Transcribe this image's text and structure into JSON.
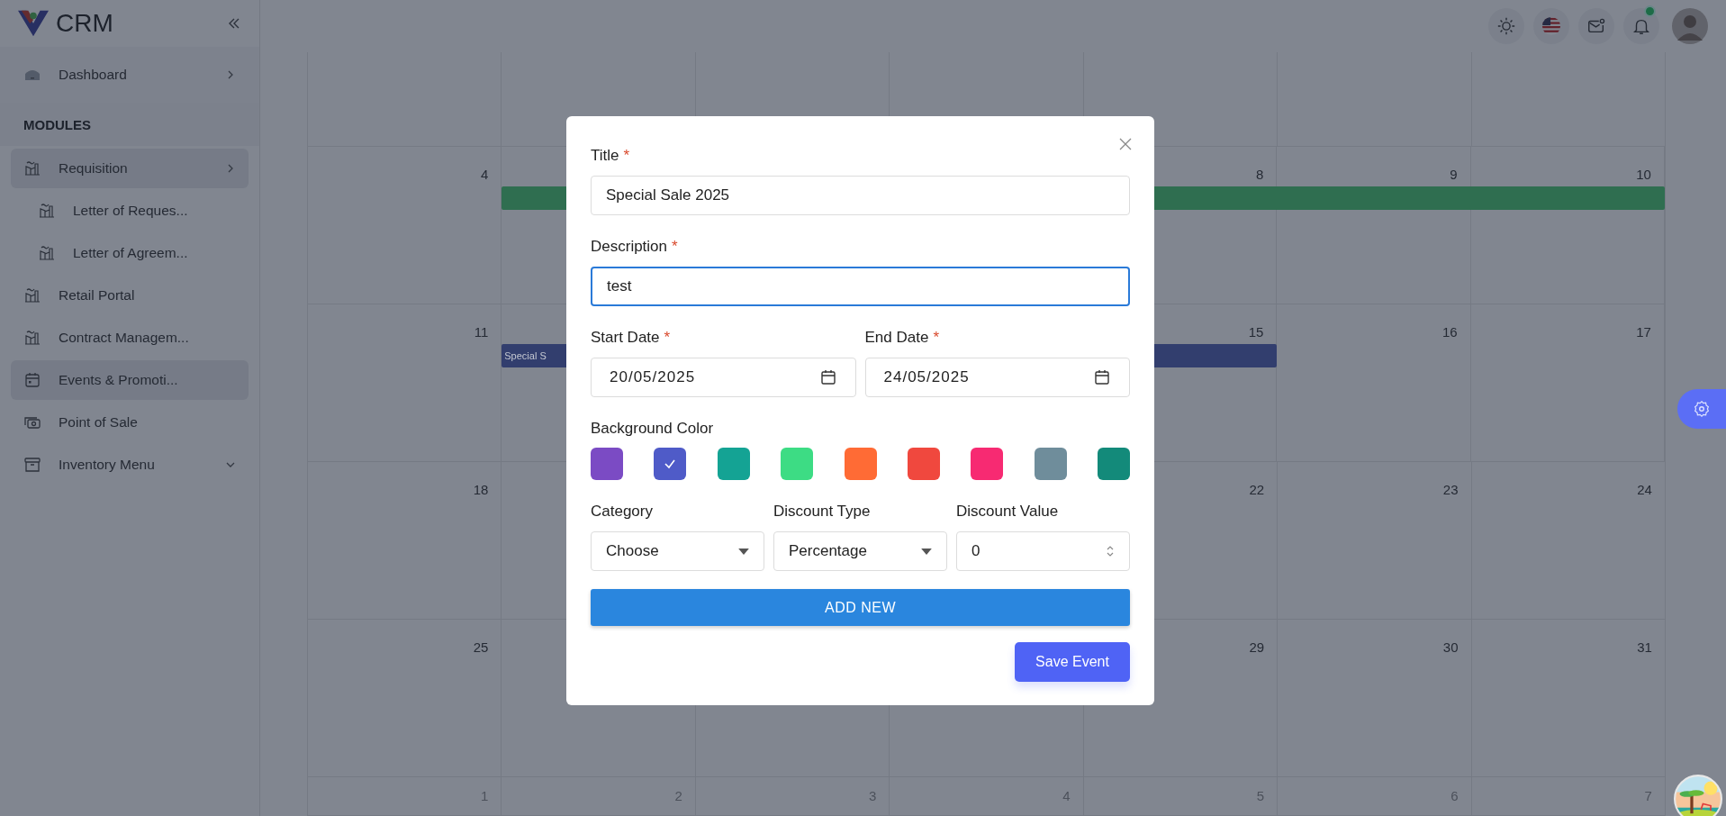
{
  "sidebar": {
    "logo": "CRM",
    "items": [
      {
        "kind": "item",
        "label": "Dashboard",
        "expanded": false,
        "selected": false
      },
      {
        "kind": "section",
        "label": "MODULES"
      },
      {
        "kind": "item",
        "label": "Requisition",
        "expanded": false,
        "selected": true,
        "children": [
          {
            "kind": "item",
            "label": "Letter of Reques...",
            "selected": false
          },
          {
            "kind": "item",
            "label": "Letter of Agreem...",
            "selected": false
          }
        ]
      },
      {
        "kind": "item",
        "label": "Retail Portal",
        "selected": false
      },
      {
        "kind": "item",
        "label": "Contract Managem...",
        "selected": false
      },
      {
        "kind": "item",
        "label": "Events & Promoti...",
        "selected": true
      },
      {
        "kind": "item",
        "label": "Point of Sale",
        "selected": false
      },
      {
        "kind": "item",
        "label": "Inventory Menu",
        "expanded": true,
        "selected": false
      }
    ]
  },
  "calendar": {
    "weeks": [
      {
        "kind": "blank"
      },
      {
        "kind": "dated",
        "days": [
          "4",
          "8",
          "9",
          "10"
        ],
        "other_month": false,
        "events": [
          {
            "color": "#2f6e50"
          }
        ]
      },
      {
        "kind": "dated",
        "days": [
          "11",
          "15",
          "16",
          "17"
        ],
        "other_month": false,
        "events": [
          {
            "label": "Special S",
            "color": "#323e6e"
          }
        ]
      },
      {
        "kind": "dated",
        "days": [
          "18",
          "22",
          "23",
          "24"
        ],
        "other_month": false
      },
      {
        "kind": "dated",
        "days": [
          "25",
          "29",
          "30",
          "31"
        ],
        "other_month": false
      },
      {
        "kind": "dated",
        "days": [
          "1",
          "2",
          "3",
          "4",
          "5",
          "6",
          "7"
        ],
        "other_month": true
      }
    ]
  },
  "modal": {
    "title": {
      "label": "Title",
      "required_mark": "*",
      "value": "Special Sale 2025",
      "focused": false
    },
    "description": {
      "label": "Description",
      "required_mark": "*",
      "value": "test",
      "focused": true
    },
    "start_date": {
      "label": "Start Date",
      "required_mark": "*",
      "value": "20/05/2025"
    },
    "end_date": {
      "label": "End Date",
      "required_mark": "*",
      "value": "24/05/2025"
    },
    "background_color": {
      "label": "Background Color",
      "swatches": [
        {
          "color": "#7b4bc4",
          "selected": false
        },
        {
          "color": "#4f5bc8",
          "selected": true
        },
        {
          "color": "#14a394",
          "selected": false
        },
        {
          "color": "#3ddc84",
          "selected": false
        },
        {
          "color": "#ff6b35",
          "selected": false
        },
        {
          "color": "#f0483e",
          "selected": false
        },
        {
          "color": "#f72a72",
          "selected": false
        },
        {
          "color": "#6f8d9b",
          "selected": false
        },
        {
          "color": "#138a7a",
          "selected": false
        }
      ]
    },
    "category": {
      "label": "Category",
      "value": "Choose"
    },
    "discount_type": {
      "label": "Discount Type",
      "value": "Percentage"
    },
    "discount_value": {
      "label": "Discount Value",
      "value": "0"
    },
    "add_button": "ADD NEW",
    "save_button": "Save Event"
  }
}
